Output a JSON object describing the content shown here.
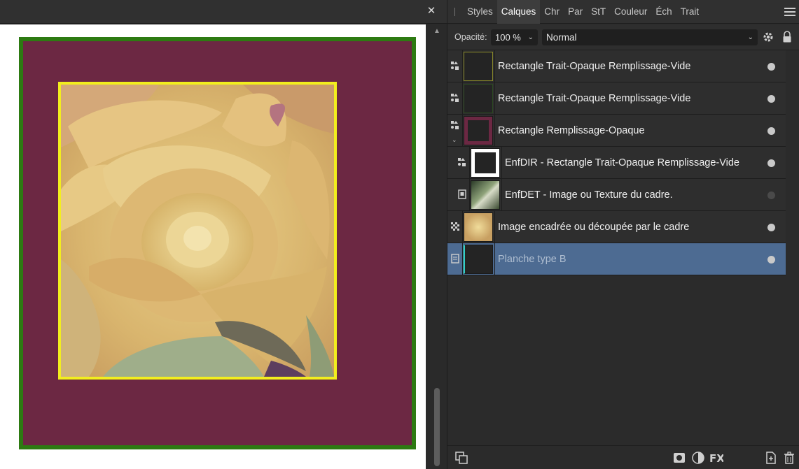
{
  "document": {
    "close_label": "✕",
    "outer_fill": "#6c2843",
    "outer_stroke": "#2d7a12",
    "inner_stroke": "#f2ee1e",
    "image_subject": "yellow rose"
  },
  "panel": {
    "tabs": [
      "Styles",
      "Calques",
      "Chr",
      "Par",
      "StT",
      "Couleur",
      "Éch",
      "Trait"
    ],
    "active_tab": "Calques",
    "opacity_label": "Opacité:",
    "opacity_value": "100 %",
    "blend_mode": "Normal",
    "selection_color": "#4d6b92"
  },
  "layers": [
    {
      "name": "Rectangle Trait-Opaque Remplissage-Vide",
      "icon": "shape-icon",
      "visible": true
    },
    {
      "name": "Rectangle Trait-Opaque Remplissage-Vide",
      "icon": "shape-icon",
      "visible": true
    },
    {
      "name": "Rectangle Remplissage-Opaque",
      "icon": "shape-icon",
      "visible": true,
      "expanded": true
    },
    {
      "name": "EnfDIR - Rectangle Trait-Opaque Remplissage-Vide",
      "icon": "shape-icon",
      "visible": true,
      "child": true
    },
    {
      "name": "EnfDET - Image ou Texture du cadre.",
      "icon": "image-icon",
      "visible": false,
      "child": true
    },
    {
      "name": "Image encadrée ou découpée par le cadre",
      "icon": "pixel-icon",
      "visible": true
    },
    {
      "name": "Planche type B",
      "icon": "artboard-icon",
      "visible": true,
      "selected": true
    }
  ]
}
